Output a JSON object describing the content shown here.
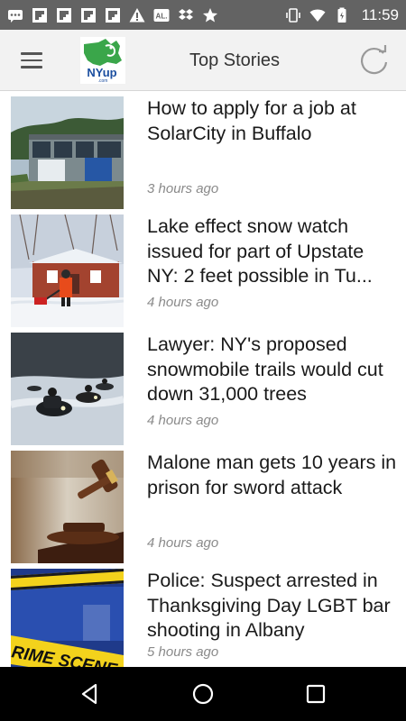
{
  "status_bar": {
    "time": "11:59",
    "left_icons": [
      "message-icon",
      "flipboard-icon",
      "flipboard-icon",
      "flipboard-icon",
      "flipboard-icon",
      "warning-icon",
      "al-icon",
      "dropbox-icon",
      "star-icon"
    ],
    "right_icons": [
      "vibrate-icon",
      "wifi-icon",
      "battery-icon"
    ]
  },
  "app_bar": {
    "title": "Top Stories",
    "logo_text": "NYup",
    "logo_suffix": ".com"
  },
  "stories": [
    {
      "headline": "How to apply for a job at SolarCity in Buffalo",
      "time": "3 hours ago",
      "thumb": "building"
    },
    {
      "headline": "Lake effect snow watch issued for part of Upstate NY: 2 feet possible in Tu...",
      "time": "4 hours ago",
      "thumb": "snow"
    },
    {
      "headline": "Lawyer: NY's proposed snowmobile trails would cut down 31,000 trees",
      "time": "4 hours ago",
      "thumb": "snowmobile"
    },
    {
      "headline": "Malone man gets 10 years in prison for sword attack",
      "time": "4 hours ago",
      "thumb": "gavel"
    },
    {
      "headline": "Police: Suspect arrested in Thanksgiving Day LGBT bar shooting in Albany",
      "time": "5 hours ago",
      "thumb": "crime-scene",
      "tape_text": "RIME SCENE"
    }
  ],
  "colors": {
    "status_bar": "#636363",
    "app_bar": "#f2f2f2",
    "logo_green": "#3aa64a",
    "logo_blue": "#1c4fa0",
    "time_text": "#8a8a8a",
    "nav_bar": "#000000"
  }
}
